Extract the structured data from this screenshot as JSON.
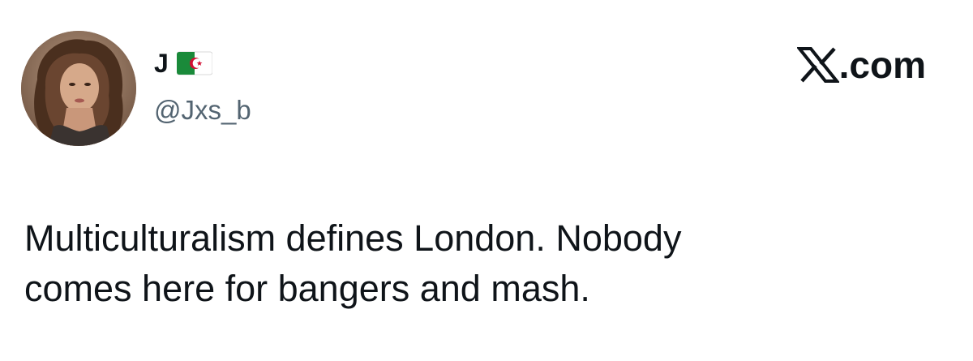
{
  "author": {
    "display_name": "J",
    "flag": "algeria-flag",
    "handle": "@Jxs_b",
    "avatar": "profile-photo"
  },
  "brand": {
    "logo": "x-logo",
    "text": ".com"
  },
  "tweet": {
    "lines": [
      "Multiculturalism defines London. Nobody",
      "comes here for bangers and mash."
    ]
  },
  "colors": {
    "text_primary": "#0f1419",
    "text_secondary": "#536471",
    "background": "#ffffff",
    "flag_green": "#1a8a3a",
    "flag_red": "#d21034"
  }
}
